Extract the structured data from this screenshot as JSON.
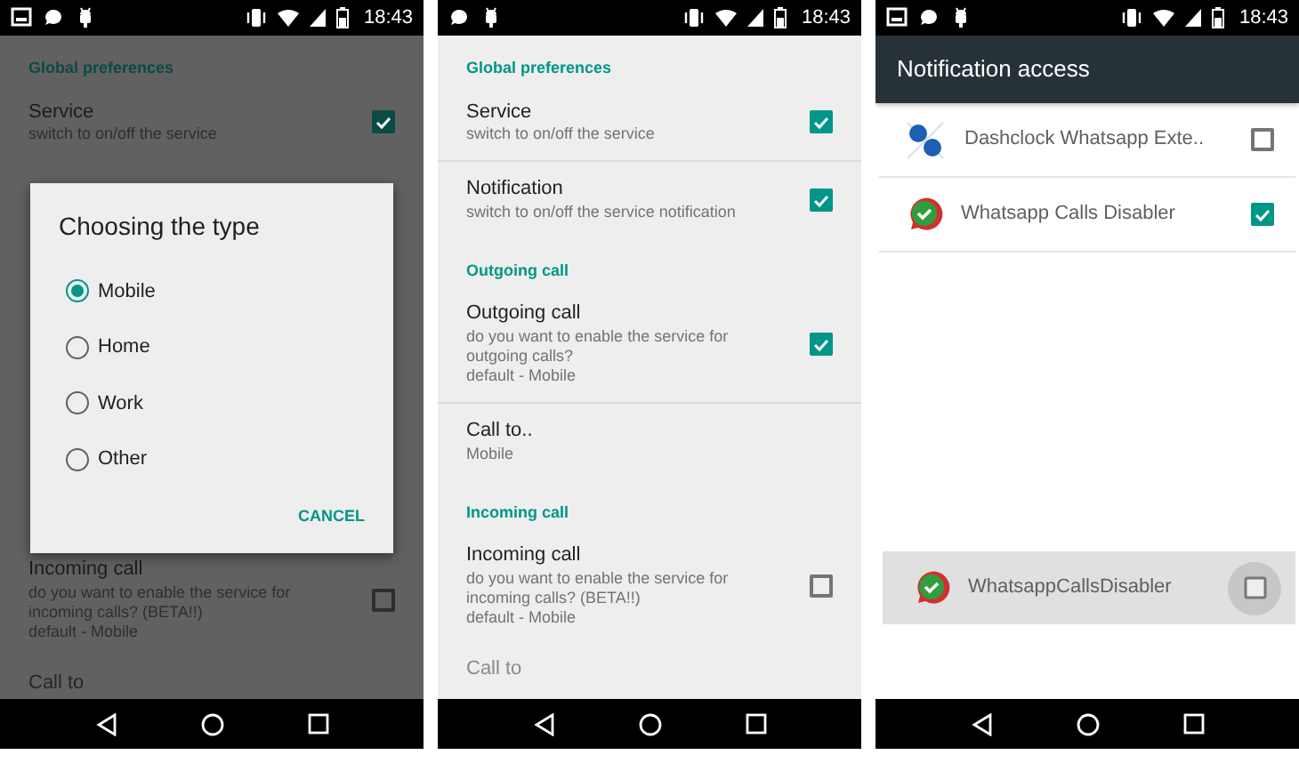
{
  "screens": [
    {
      "kind": "settings",
      "status_bar": {
        "notifications": [
          {
            "kind": "image"
          },
          {
            "kind": "chat"
          },
          {
            "kind": "android"
          }
        ],
        "time": "18:43"
      },
      "sections": [
        {
          "header": "Global preferences",
          "items": [
            {
              "title": "Service",
              "summary": [
                "switch to on/off the service"
              ],
              "checked": true
            }
          ]
        },
        {
          "items": [
            {
              "title": "Incoming call",
              "summary": [
                "do you want to enable the service for incoming calls? (BETA!!)",
                "default - Mobile"
              ],
              "checked": false
            },
            {
              "title": "Call to",
              "kind": "cut"
            }
          ]
        }
      ],
      "dialog": {
        "title": "Choosing the type",
        "options": [
          {
            "label": "Mobile",
            "selected": true
          },
          {
            "label": "Home",
            "selected": false
          },
          {
            "label": "Work",
            "selected": false
          },
          {
            "label": "Other",
            "selected": false
          }
        ],
        "button": "CANCEL"
      }
    },
    {
      "kind": "settings",
      "status_bar": {
        "notifications": [
          {
            "kind": "chat"
          },
          {
            "kind": "android"
          }
        ],
        "time": "18:43"
      },
      "sections": [
        {
          "header": "Global preferences",
          "items": [
            {
              "title": "Service",
              "summary": [
                "switch to on/off the service"
              ],
              "checked": true
            },
            {
              "title": "Notification",
              "summary": [
                "switch to on/off the service notification"
              ],
              "checked": true
            }
          ]
        },
        {
          "header": "Outgoing call",
          "items": [
            {
              "title": "Outgoing call",
              "summary": [
                "do you want to enable the service for outgoing calls?",
                "default - Mobile"
              ],
              "checked": true
            },
            {
              "title": "Call to..",
              "summary": [
                "Mobile"
              ]
            }
          ]
        },
        {
          "header": "Incoming call",
          "items": [
            {
              "title": "Incoming call",
              "summary": [
                "do you want to enable the service for incoming calls? (BETA!!)",
                "default - Mobile"
              ],
              "checked": false
            },
            {
              "title": "Call to",
              "kind": "cut"
            }
          ]
        }
      ]
    },
    {
      "kind": "app_list",
      "status_bar": {
        "notifications": [
          {
            "kind": "image"
          },
          {
            "kind": "chat"
          },
          {
            "kind": "android"
          }
        ],
        "time": "18:43"
      },
      "title": "Notification access",
      "apps": [
        {
          "name": "Dashclock Whatsapp Exte..",
          "kind": "dashclock",
          "checked": false
        },
        {
          "name": "Whatsapp Calls Disabler",
          "kind": "calls_disabler",
          "checked": true
        }
      ],
      "drag_item": {
        "name": "WhatsappCallsDisabler",
        "kind": "calls_disabler"
      }
    }
  ]
}
